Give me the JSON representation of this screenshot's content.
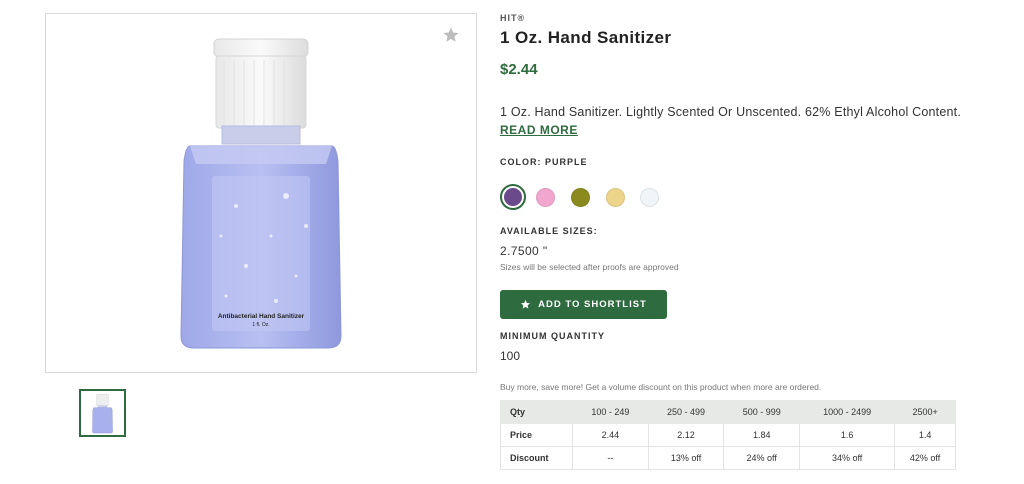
{
  "product": {
    "brand": "HIT®",
    "title": "1 Oz. Hand Sanitizer",
    "price": "$2.44",
    "description": "1 Oz. Hand Sanitizer. Lightly Scented Or Unscented. 62% Ethyl Alcohol Content.",
    "read_more": "READ MORE",
    "image_label_line1": "Antibacterial Hand Sanitizer",
    "image_label_line2": "1 fl. Oz."
  },
  "color": {
    "label": "COLOR: PURPLE",
    "swatches": [
      {
        "name": "purple",
        "hex": "#6a4a8a",
        "selected": true
      },
      {
        "name": "pink",
        "hex": "#f1a6d0",
        "selected": false
      },
      {
        "name": "olive",
        "hex": "#8a8a1e",
        "selected": false
      },
      {
        "name": "yellow",
        "hex": "#ecd48a",
        "selected": false
      },
      {
        "name": "clear",
        "hex": "#f1f5f8",
        "selected": false
      }
    ]
  },
  "sizes": {
    "label": "AVAILABLE SIZES:",
    "value": "2.7500 \"",
    "note": "Sizes will be selected after proofs are approved"
  },
  "shortlist": {
    "label": "ADD TO SHORTLIST",
    "icon": "star-icon"
  },
  "minimum": {
    "label": "MINIMUM QUANTITY",
    "value": "100"
  },
  "pricing": {
    "note": "Buy more, save more! Get a volume discount on this product when more are ordered.",
    "rows": [
      [
        "Qty",
        "100 - 249",
        "250 - 499",
        "500 - 999",
        "1000 - 2499",
        "2500+"
      ],
      [
        "Price",
        "2.44",
        "2.12",
        "1.84",
        "1.6",
        "1.4"
      ],
      [
        "Discount",
        "--",
        "13% off",
        "24% off",
        "34% off",
        "42% off"
      ]
    ]
  },
  "colors": {
    "accent": "#2e6b3e",
    "table_header_bg": "#e6e9e6"
  }
}
